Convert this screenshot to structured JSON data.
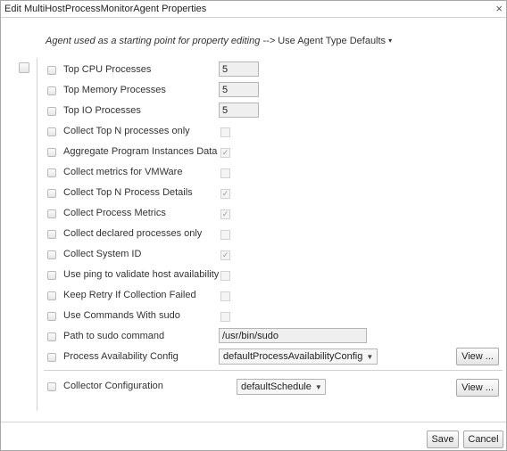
{
  "dialog": {
    "title": "Edit MultiHostProcessMonitorAgent Properties",
    "close_glyph": "×"
  },
  "agent_source": {
    "prefix": "Agent used as a starting point for property editing -->",
    "value": "Use Agent Type Defaults",
    "chevron": "▾"
  },
  "properties": [
    {
      "label": "Top CPU Processes",
      "type": "number",
      "value": "5"
    },
    {
      "label": "Top Memory Processes",
      "type": "number",
      "value": "5"
    },
    {
      "label": "Top IO Processes",
      "type": "number",
      "value": "5"
    },
    {
      "label": "Collect Top N processes only",
      "type": "checkbox",
      "checked": false
    },
    {
      "label": "Aggregate Program Instances Data",
      "type": "checkbox",
      "checked": true
    },
    {
      "label": "Collect metrics for VMWare",
      "type": "checkbox",
      "checked": false
    },
    {
      "label": "Collect Top N Process Details",
      "type": "checkbox",
      "checked": true
    },
    {
      "label": "Collect Process Metrics",
      "type": "checkbox",
      "checked": true
    },
    {
      "label": "Collect declared processes only",
      "type": "checkbox",
      "checked": false
    },
    {
      "label": "Collect System ID",
      "type": "checkbox",
      "checked": true
    },
    {
      "label": "Use ping to validate host availability",
      "type": "checkbox",
      "checked": false
    },
    {
      "label": "Keep Retry If Collection Failed",
      "type": "checkbox",
      "checked": false
    },
    {
      "label": "Use Commands With sudo",
      "type": "checkbox",
      "checked": false
    },
    {
      "label": "Path to sudo command",
      "type": "text",
      "value": "/usr/bin/sudo"
    },
    {
      "label": "Process Availability Config",
      "type": "select",
      "value": "defaultProcessAvailabilityConfig",
      "button": "View ..."
    }
  ],
  "collector": {
    "label": "Collector Configuration",
    "value": "defaultSchedule",
    "button": "View ..."
  },
  "select_arrow": "▼",
  "check_glyph": "✓",
  "footer": {
    "save": "Save",
    "cancel": "Cancel"
  }
}
